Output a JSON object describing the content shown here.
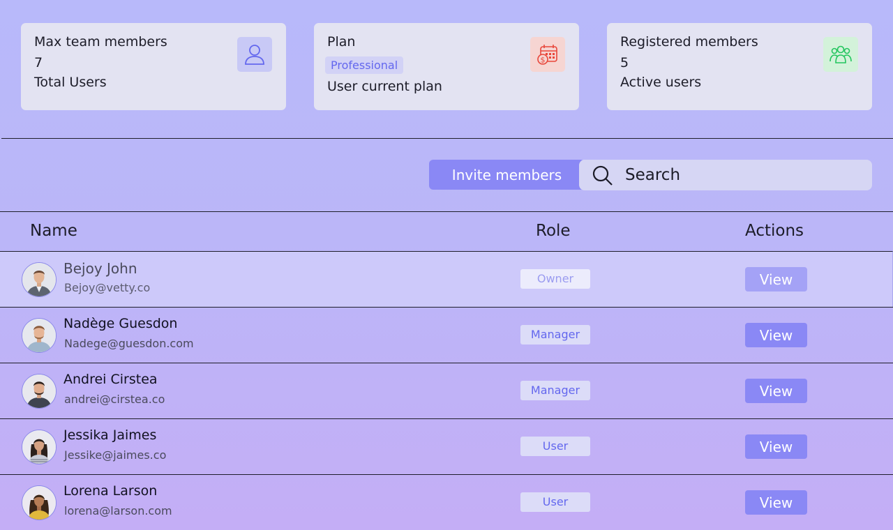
{
  "stats": {
    "max_members": {
      "title": "Max team members",
      "value": "7",
      "subtitle": "Total Users",
      "icon": "user-icon",
      "icon_color": "#6367ee"
    },
    "plan": {
      "title": "Plan",
      "badge": "Professional",
      "subtitle": "User current plan",
      "icon": "calendar-dollar-icon",
      "icon_color": "#e8473b"
    },
    "registered": {
      "title": "Registered  members",
      "value": "5",
      "subtitle": "Active users",
      "icon": "users-group-icon",
      "icon_color": "#22c55e"
    }
  },
  "toolbar": {
    "invite_label": "Invite members",
    "search_placeholder": "Search"
  },
  "table": {
    "columns": {
      "name": "Name",
      "role": "Role",
      "actions": "Actions"
    },
    "rows": [
      {
        "name": "Bejoy John",
        "email": "Bejoy@vetty.co",
        "role": "Owner",
        "action": "View"
      },
      {
        "name": "Nadège Guesdon",
        "email": "Nadege@guesdon.com",
        "role": "Manager",
        "action": "View"
      },
      {
        "name": "Andrei Cirstea",
        "email": "andrei@cirstea.co",
        "role": "Manager",
        "action": "View"
      },
      {
        "name": "Jessika Jaimes",
        "email": "Jessike@jaimes.co",
        "role": "User",
        "action": "View"
      },
      {
        "name": "Lorena Larson",
        "email": "lorena@larson.com",
        "role": "User",
        "action": "View"
      }
    ]
  },
  "colors": {
    "accent": "#8a88f5",
    "badge_text": "#6367ee"
  }
}
